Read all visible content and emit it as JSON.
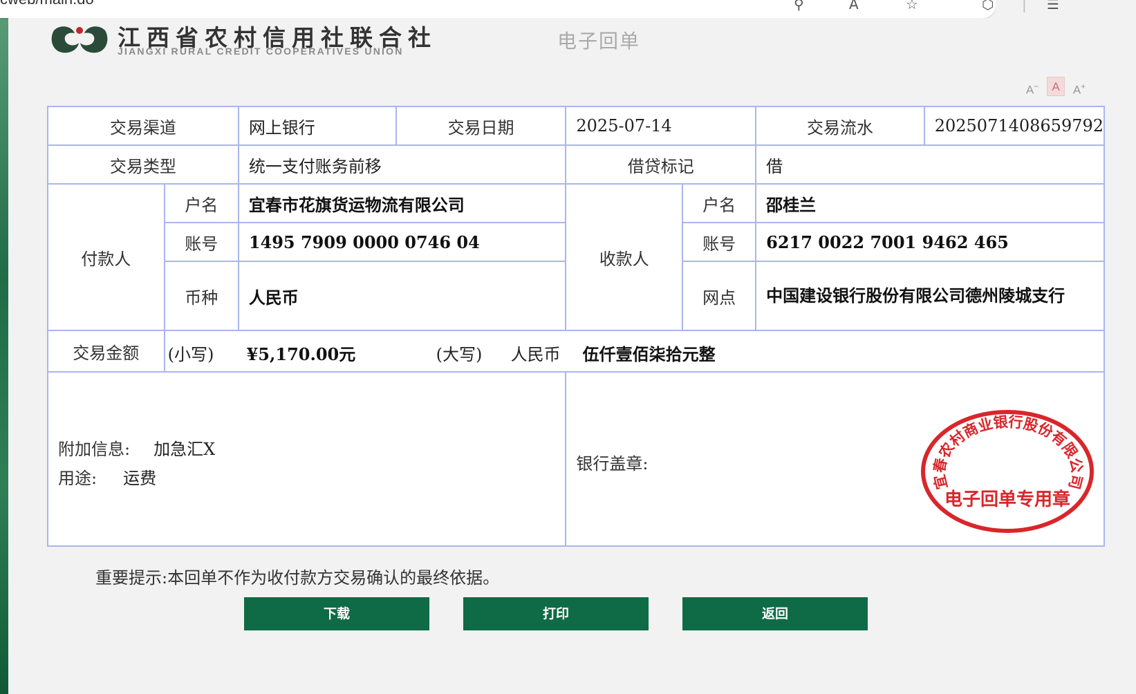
{
  "browser": {
    "url_fragment": "cweb/main.do"
  },
  "header": {
    "org_name_cn": "江西省农村信用社联合社",
    "org_name_en": "JIANGXI RURAL CREDIT COOPERATIVES UNION",
    "doc_title": "电子回单"
  },
  "font_tools": {
    "decrease": "A",
    "normal": "A",
    "increase": "A"
  },
  "receipt": {
    "channel_label": "交易渠道",
    "channel": "网上银行",
    "date_label": "交易日期",
    "date": "2025-07-14",
    "serial_label": "交易流水",
    "serial": "2025071408659792",
    "type_label": "交易类型",
    "type": "统一支付账务前移",
    "dc_label": "借贷标记",
    "dc": "借",
    "payer_label": "付款人",
    "payer_name_label": "户名",
    "payer_name": "宜春市花旗货运物流有限公司",
    "payer_acct_label": "账号",
    "payer_acct": "1495 7909 0000 0746 04",
    "currency_label": "币种",
    "currency": "人民币",
    "payee_label": "收款人",
    "payee_name_label": "户名",
    "payee_name": "邵桂兰",
    "payee_acct_label": "账号",
    "payee_acct": "6217 0022 7001 9462 465",
    "payee_branch_label": "网点",
    "payee_branch": "中国建设银行股份有限公司德州陵城支行",
    "amount_label": "交易金额",
    "amount_small_label": "(小写)",
    "amount_small": "¥5,170.00元",
    "amount_big_label": "(大写)",
    "amount_big_currency": "人民币",
    "amount_big": "伍仟壹佰柒拾元整",
    "extra_label": "附加信息:",
    "extra": "加急汇X",
    "purpose_label": "用途:",
    "purpose": "运费",
    "seal_label": "银行盖章:",
    "stamp_top": "宜春农村商业银行股份有限公司",
    "stamp_bottom": "电子回单专用章"
  },
  "notice": "重要提示:本回单不作为收付款方交易确认的最终依据。",
  "buttons": {
    "download": "下载",
    "print": "打印",
    "back": "返回"
  },
  "colors": {
    "accent": "#0f6b45",
    "table_border": "#a9b5ee",
    "stamp": "#d9262b"
  }
}
